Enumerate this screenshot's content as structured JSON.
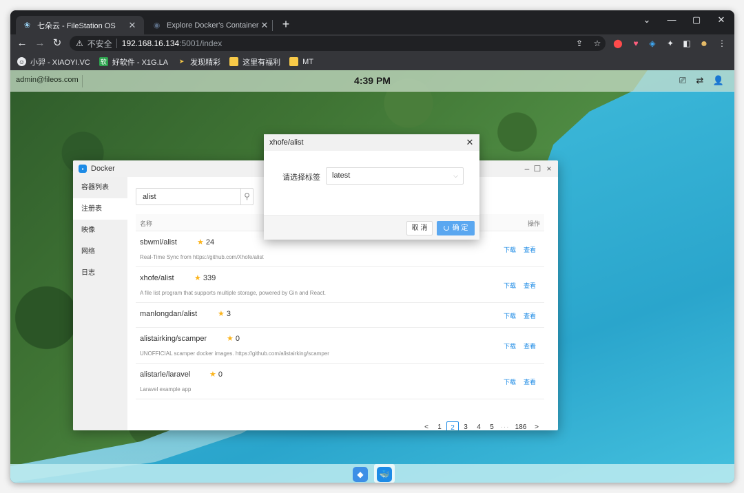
{
  "browser": {
    "tabs": [
      {
        "title": "七朵云 - FileStation OS",
        "active": true
      },
      {
        "title": "Explore Docker's Container Im",
        "active": false
      }
    ],
    "new_tab": "+",
    "url": {
      "insecure_label": "不安全",
      "host": "192.168.16.134",
      "rest": ":5001/index"
    },
    "bookmarks": [
      {
        "label": "小羿 - XIAOYI.VC",
        "color": "#e8eaed"
      },
      {
        "label": "好软件 - X1G.LA",
        "color": "#2ea44f"
      },
      {
        "label": "发现精彩",
        "color": "#f7c948"
      },
      {
        "label": "这里有福利",
        "color": "#f7c948"
      },
      {
        "label": "MT",
        "color": "#f7c948"
      }
    ]
  },
  "desktop": {
    "user": "admin@fileos.com",
    "clock": "4:39 PM"
  },
  "docker_window": {
    "title": "Docker",
    "sidebar": [
      "容器列表",
      "注册表",
      "映像",
      "网络",
      "日志"
    ],
    "active_sidebar": 1,
    "search_value": "alist",
    "table_headers": {
      "name": "名称",
      "action": "操作"
    },
    "rows": [
      {
        "name": "sbwml/alist",
        "stars": "24",
        "desc": "Real-Time Sync from https://github.com/Xhofe/alist"
      },
      {
        "name": "xhofe/alist",
        "stars": "339",
        "desc": "A file list program that supports multiple storage, powered by Gin and React."
      },
      {
        "name": "manlongdan/alist",
        "stars": "3",
        "desc": ""
      },
      {
        "name": "alistairking/scamper",
        "stars": "0",
        "desc": "UNOFFICIAL scamper docker images. https://github.com/alistairking/scamper"
      },
      {
        "name": "alistarle/laravel",
        "stars": "0",
        "desc": "Laravel example app"
      }
    ],
    "row_actions": {
      "download": "下载",
      "view": "查看"
    },
    "pagination": {
      "prev": "<",
      "pages": [
        "1",
        "2",
        "3",
        "4",
        "5"
      ],
      "current": "2",
      "ellipsis": "···",
      "last": "186",
      "next": ">"
    }
  },
  "modal": {
    "title": "xhofe/alist",
    "label": "请选择标签",
    "select_value": "latest",
    "cancel": "取 消",
    "ok": "确 定"
  },
  "colors": {
    "accent": "#1d8be6",
    "star": "#fbb41c"
  }
}
